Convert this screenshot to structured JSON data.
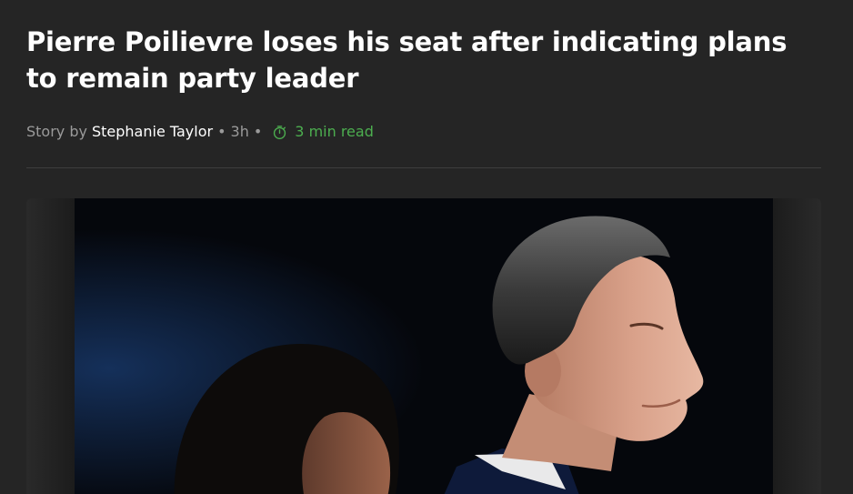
{
  "article": {
    "headline": "Pierre Poilievre loses his seat after indicating plans to remain party leader",
    "byline": {
      "prefix": "Story by",
      "author": "Stephanie Taylor",
      "age": "3h",
      "separator": "•",
      "read_time": "3 min read",
      "read_time_icon": "timer-icon"
    }
  },
  "colors": {
    "background": "#252525",
    "headline": "#ffffff",
    "meta_text": "#9a9a9a",
    "author": "#ffffff",
    "read_time": "#4cae4f",
    "divider": "#3d3d3d"
  },
  "photo": {
    "alt": "Pierre Poilievre in profile with a woman beside him"
  }
}
